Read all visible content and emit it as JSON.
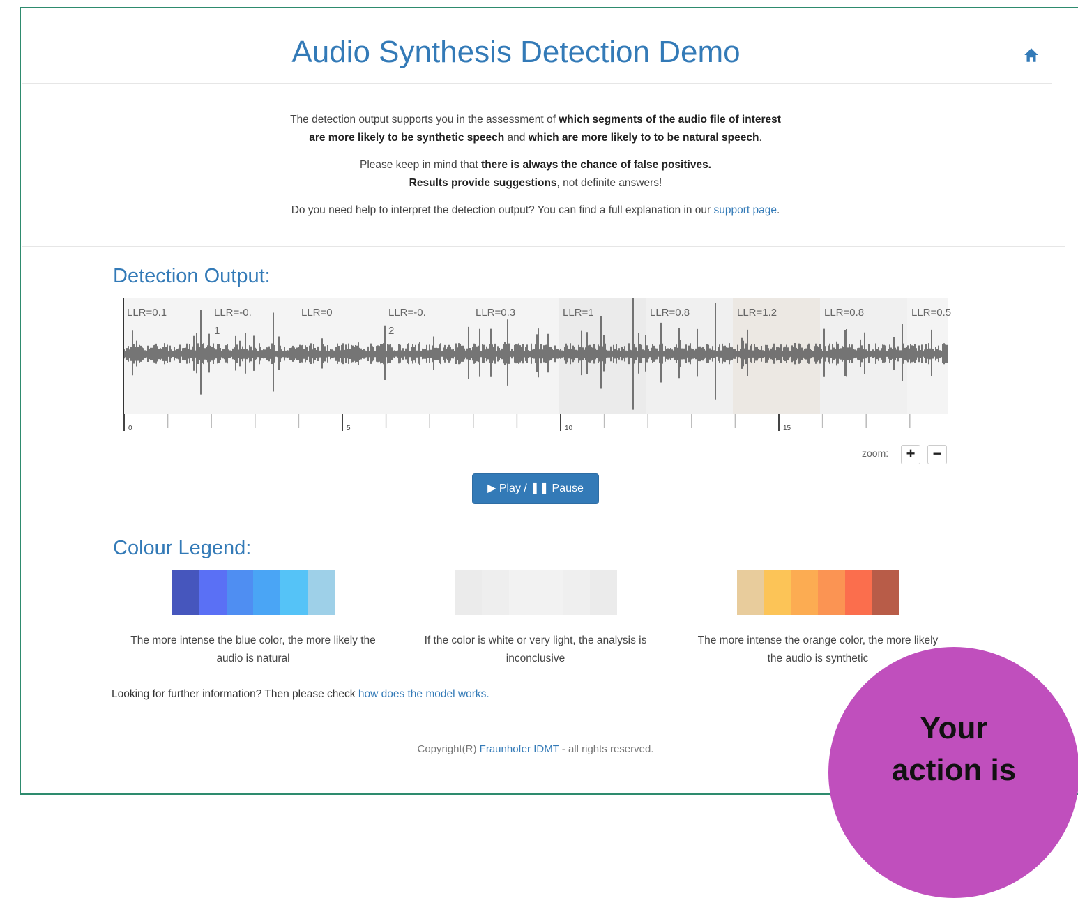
{
  "header": {
    "title": "Audio Synthesis Detection Demo",
    "home_icon": "home-icon"
  },
  "intro": {
    "p1_a": "The detection output supports you in the assessment of ",
    "p1_b": "which segments of the audio file of interest",
    "p1_c": "are more likely to be synthetic speech",
    "p1_d": " and ",
    "p1_e": "which are more likely to to be natural speech",
    "p1_f": ".",
    "p2_a": "Please keep in mind that ",
    "p2_b": "there is always the chance of false positives.",
    "p2_c": "Results provide suggestions",
    "p2_d": ", not definite answers!",
    "p3_a": "Do you need help to interpret the detection output? You can find a full explanation in our ",
    "p3_link": "support page",
    "p3_b": "."
  },
  "detection": {
    "title": "Detection Output:",
    "segments": [
      {
        "label": "LLR=0.1",
        "color": "#f4f4f4"
      },
      {
        "label": "LLR=-0.1",
        "color": "#f4f4f4"
      },
      {
        "label": "LLR=0",
        "color": "#f4f4f4"
      },
      {
        "label": "LLR=-0.2",
        "color": "#f4f4f4"
      },
      {
        "label": "LLR=0.3",
        "color": "#f4f4f4"
      },
      {
        "label": "LLR=1",
        "color": "#ebebeb"
      },
      {
        "label": "LLR=0.8",
        "color": "#f0f0f0"
      },
      {
        "label": "LLR=1.2",
        "color": "#ece8e3"
      },
      {
        "label": "LLR=0.8",
        "color": "#f0f0f0"
      },
      {
        "label": "LLR=0.5",
        "color": "#f4f4f4"
      }
    ],
    "axis_ticks": [
      "0",
      "5",
      "10",
      "15"
    ],
    "zoom_label": "zoom:",
    "zoom_in": "+",
    "zoom_out": "−",
    "play_label": "▶ Play / ❚❚ Pause"
  },
  "legend": {
    "title": "Colour Legend:",
    "blue": [
      "#4656bd",
      "#5a70f5",
      "#4f8ef2",
      "#4aa5f5",
      "#55c3f7",
      "#9ed0e8"
    ],
    "grey": [
      "#ebebeb",
      "#eeeeee",
      "#f2f2f2",
      "#f2f2f2",
      "#efefef",
      "#ebebeb"
    ],
    "orange": [
      "#e8cc9c",
      "#fcc457",
      "#fcac52",
      "#fb9453",
      "#fb6e4d",
      "#b85c48"
    ],
    "blue_text": "The more intense the blue color, the more likely the audio is natural",
    "grey_text": "If the color is white or very light, the analysis is inconclusive",
    "orange_text": "The more intense the orange color, the more likely the audio is synthetic"
  },
  "note": {
    "text": "Looking for further information? Then please check ",
    "link": "how does the model works."
  },
  "footer": {
    "a": "Copyright(R) ",
    "link": "Fraunhofer IDMT",
    "b": " - all rights reserved."
  },
  "badge": {
    "line1": "Your",
    "line2": "action is"
  }
}
